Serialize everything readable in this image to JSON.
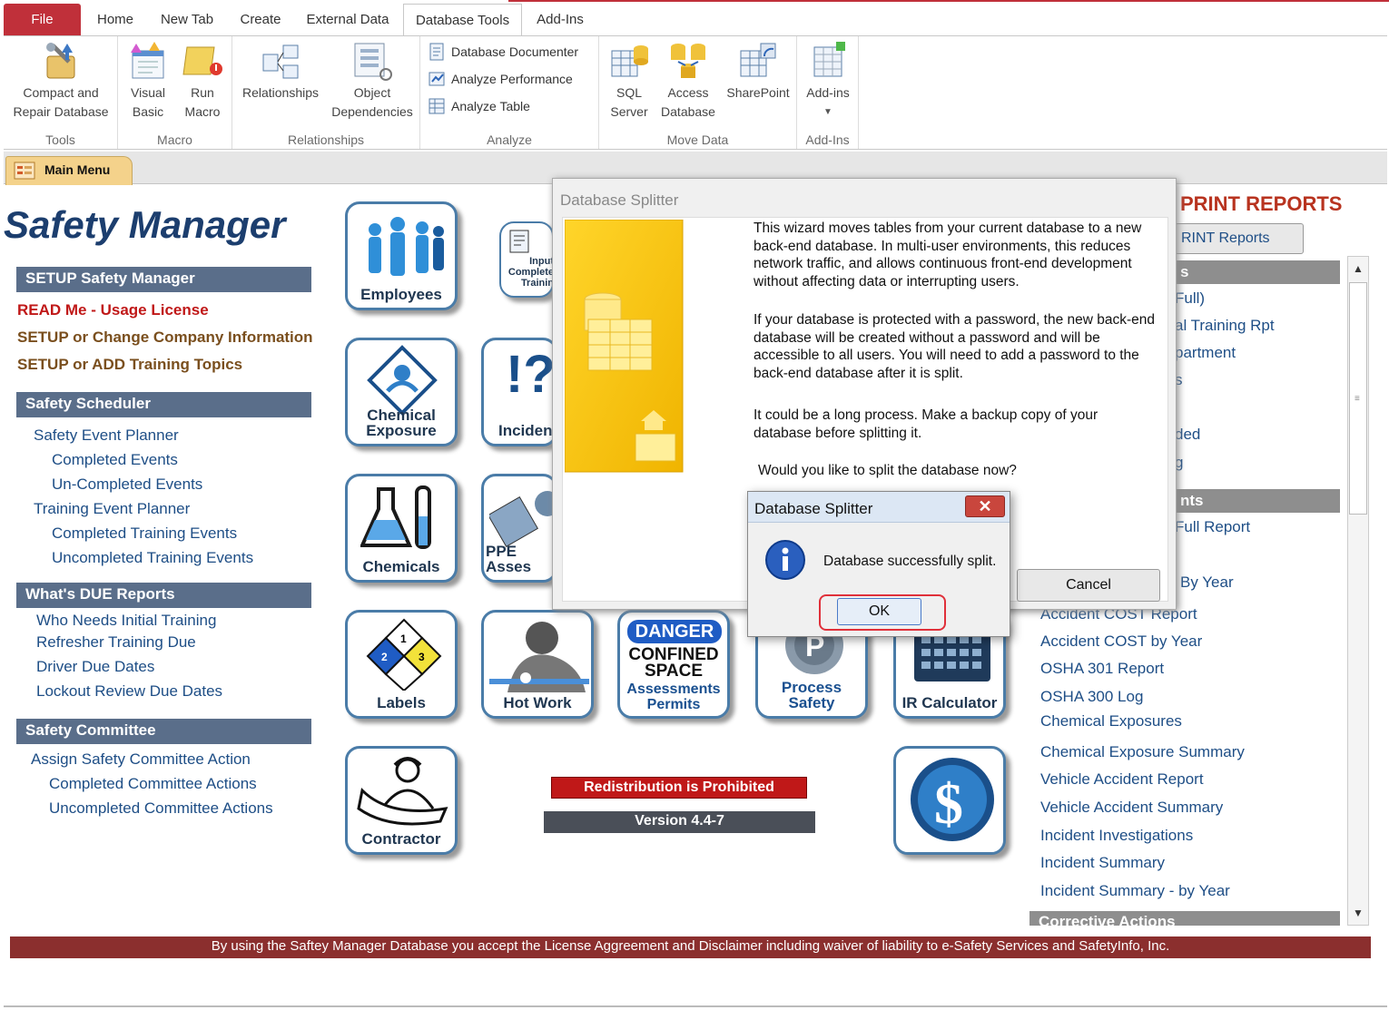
{
  "ribbon": {
    "tabs": {
      "file": "File",
      "home": "Home",
      "new_tab": "New Tab",
      "create": "Create",
      "external_data": "External Data",
      "database_tools": "Database Tools",
      "add_ins": "Add-Ins"
    },
    "tools": {
      "compact_l1": "Compact and",
      "compact_l2": "Repair Database",
      "label": "Tools"
    },
    "macro": {
      "vb_l1": "Visual",
      "vb_l2": "Basic",
      "run_l1": "Run",
      "run_l2": "Macro",
      "label": "Macro"
    },
    "relationships": {
      "rel": "Relationships",
      "obj_l1": "Object",
      "obj_l2": "Dependencies",
      "label": "Relationships"
    },
    "analyze": {
      "documenter": "Database Documenter",
      "performance": "Analyze Performance",
      "table": "Analyze Table",
      "label": "Analyze"
    },
    "move_data": {
      "sql_l1": "SQL",
      "sql_l2": "Server",
      "access_l1": "Access",
      "access_l2": "Database",
      "sharepoint": "SharePoint",
      "label": "Move Data"
    },
    "addins": {
      "btn": "Add-ins",
      "label": "Add-Ins"
    }
  },
  "doc_tab": "Main Menu",
  "form": {
    "title": "Safety Manager",
    "left": {
      "setup_header": "SETUP Safety Manager",
      "read_me": "READ Me -  Usage License",
      "company": "SETUP or Change Company Information",
      "topics": "SETUP or ADD Training Topics",
      "scheduler_header": "Safety Scheduler",
      "event_planner": "Safety Event Planner",
      "completed_events": "Completed Events",
      "uncompleted_events": "Un-Completed Events",
      "training_planner": "Training Event Planner",
      "completed_training": "Completed Training Events",
      "uncompleted_training": "Uncompleted Training Events",
      "due_header": "What's DUE Reports",
      "initial_training": "Who Needs Initial Training",
      "refresher": "Refresher Training Due",
      "driver": "Driver Due Dates",
      "lockout": "Lockout Review Due Dates",
      "committee_header": "Safety Committee",
      "assign_action": "Assign Safety Committee Action",
      "completed_actions": "Completed Committee Actions",
      "uncompleted_actions": "Uncompleted Committee Actions"
    },
    "tiles": {
      "employees": "Employees",
      "input_training": "Input Complete Trainin",
      "chemical_l1": "Chemical",
      "chemical_l2": "Exposure",
      "incidents": "Inciden",
      "chemicals": "Chemicals",
      "ppe": "PPE Asses",
      "labels": "Labels",
      "hot_work": "Hot Work",
      "confined_danger": "DANGER",
      "confined_l1": "CONFINED",
      "confined_l2": "SPACE",
      "confined_l3": "Assessments",
      "confined_l4": "Permits",
      "process_l1": "Process",
      "process_l2": "Safety",
      "ir_calc": "IR Calculator",
      "contractor": "Contractor"
    },
    "redistribution": "Redistribution is Prohibited",
    "version": "Version 4.4-7",
    "right": {
      "print_header": "PRINT REPORTS",
      "print_button": "RINT Reports",
      "section1_header": "s",
      "items_a": [
        "Full)",
        "al Training Rpt",
        "partment",
        "s",
        "",
        "ded",
        "g"
      ],
      "section2_header": "nts",
      "items_b": [
        "Full Report",
        "",
        "By Year",
        "Accident COST Report",
        "Accident COST by Year",
        "OSHA 301 Report",
        "OSHA 300 Log",
        "Chemical Exposures",
        "Chemical Exposure Summary",
        "Vehicle Accident Report",
        "Vehicle Accident Summary",
        "Incident Investigations",
        "Incident Summary",
        "Incident  Summary - by Year"
      ],
      "section3_header": "Corrective Actions"
    },
    "footer": "By using the Saftey Manager Database you accept the License Aggreement and Disclaimer including waiver of liability to e-Safety Services and SafetyInfo, Inc."
  },
  "wizard": {
    "title": "Database Splitter",
    "p1": "This wizard moves tables from your current database to a new back-end database. In multi-user environments, this reduces network traffic, and allows continuous front-end development without affecting data or interrupting users.",
    "p2": "If your database is protected with a password, the new back-end database will be created without a password and will be accessible to all users.  You will need to add a password to the back-end database after it is split.",
    "p3": "It could be a long process. Make a backup copy of your database before splitting it.",
    "p4": "Would you like to split the database now?",
    "cancel": "Cancel"
  },
  "msgbox": {
    "title": "Database Splitter",
    "message": "Database successfully split.",
    "ok": "OK",
    "close": "✕",
    "icon": "info-icon"
  },
  "colors": {
    "file_tab": "#c0303a",
    "header_bar": "#5a6e8a",
    "footer": "#8b2f2e",
    "redistribution": "#c01818",
    "version_bar": "#4a4f58",
    "print_title": "#b8331f",
    "highlight": "#e0303a"
  }
}
